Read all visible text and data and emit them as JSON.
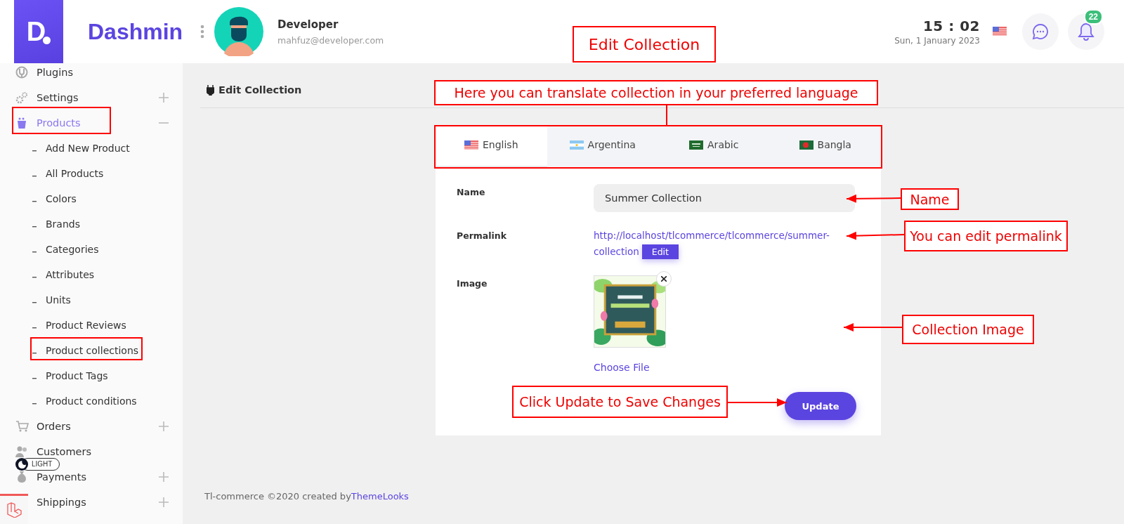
{
  "brand": {
    "mark": "D",
    "name": "Dashmin"
  },
  "user": {
    "name": "Developer",
    "email": "mahfuz@developer.com"
  },
  "clock": {
    "time": "15 : 02",
    "date": "Sun, 1 January 2023"
  },
  "notifications": {
    "count": "22"
  },
  "sidebar": {
    "items": [
      {
        "label": "Plugins",
        "selected": false
      },
      {
        "label": "Settings",
        "selected": false,
        "expanded": false
      },
      {
        "label": "Products",
        "selected": true,
        "expanded": true,
        "children": [
          {
            "label": "Add New Product",
            "selected": false
          },
          {
            "label": "All Products",
            "selected": false
          },
          {
            "label": "Colors",
            "selected": false
          },
          {
            "label": "Brands",
            "selected": false
          },
          {
            "label": "Categories",
            "selected": false
          },
          {
            "label": "Attributes",
            "selected": false
          },
          {
            "label": "Units",
            "selected": false
          },
          {
            "label": "Product Reviews",
            "selected": false
          },
          {
            "label": "Product collections",
            "selected": false
          },
          {
            "label": "Product Tags",
            "selected": false
          },
          {
            "label": "Product conditions",
            "selected": false
          }
        ]
      },
      {
        "label": "Orders",
        "selected": false,
        "expanded": false
      },
      {
        "label": "Customers",
        "selected": false
      },
      {
        "label": "Payments",
        "selected": false,
        "expanded": false
      },
      {
        "label": "Shippings",
        "selected": false,
        "expanded": false
      }
    ]
  },
  "theme_toggle": {
    "label": "LIGHT"
  },
  "page": {
    "title": "Edit Collection"
  },
  "tabs": [
    {
      "label": "English",
      "selected": true
    },
    {
      "label": "Argentina",
      "selected": false
    },
    {
      "label": "Arabic",
      "selected": false
    },
    {
      "label": "Bangla",
      "selected": false
    }
  ],
  "form": {
    "name_label": "Name",
    "name_value": "Summer Collection",
    "permalink_label": "Permalink",
    "permalink": "http://localhost/tlcommerce/tlcommerce/summer-collection",
    "edit_button": "Edit",
    "image_label": "Image",
    "choose_file": "Choose File",
    "update_button": "Update"
  },
  "footer": {
    "text": "Tl-commerce ©2020 created by",
    "link": "ThemeLooks"
  },
  "annotations": [
    "Edit Collection",
    "Here you can translate collection in your preferred language",
    "Name",
    "You can edit permalink",
    "Collection Image",
    "Click Update to Save Changes"
  ]
}
